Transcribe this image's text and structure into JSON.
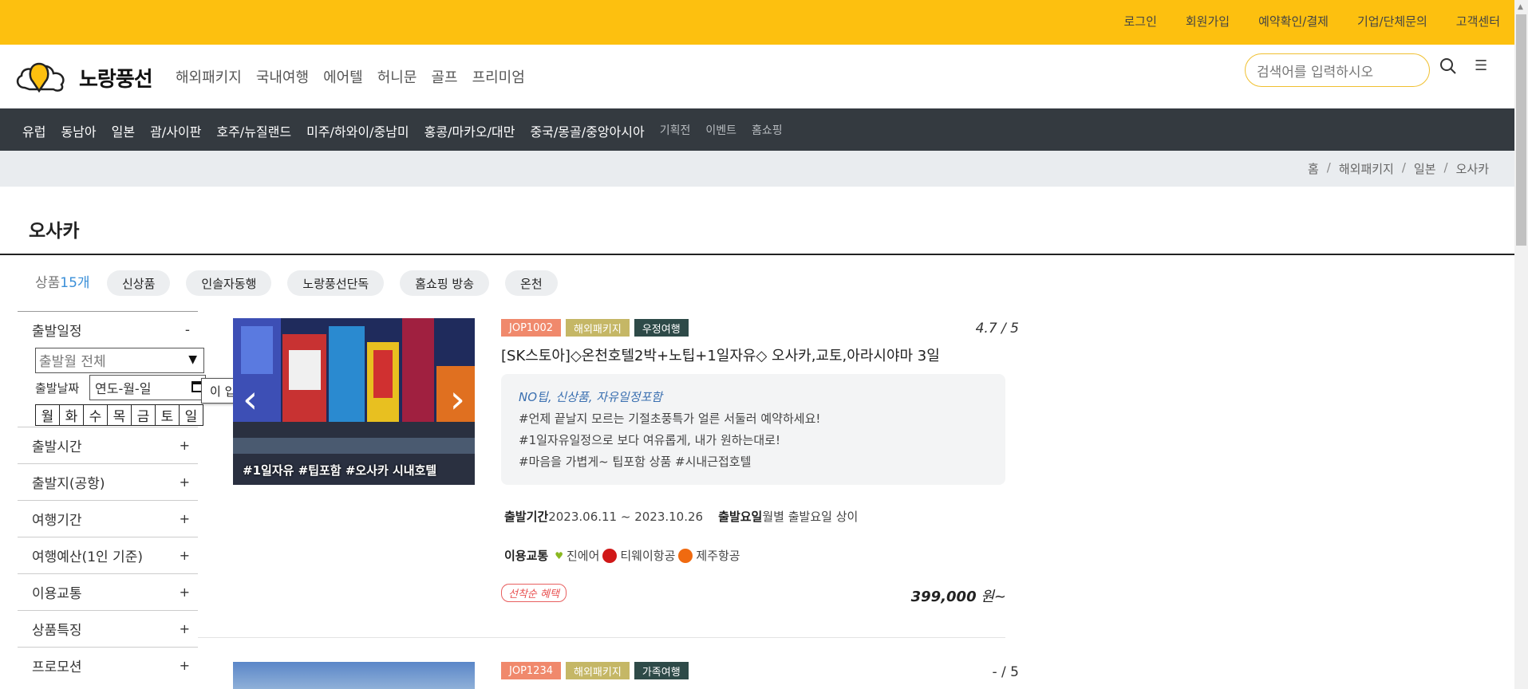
{
  "topbar": {
    "links": [
      "로그인",
      "회원가입",
      "예약확인/결제",
      "기업/단체문의",
      "고객센터"
    ]
  },
  "header": {
    "logo_text": "노랑풍선",
    "nav": [
      "해외패키지",
      "국내여행",
      "에어텔",
      "허니문",
      "골프",
      "프리미엄"
    ],
    "search_placeholder": "검색어를 입력하시오"
  },
  "category_bar": {
    "items": [
      "유럽",
      "동남아",
      "일본",
      "괌/사이판",
      "호주/뉴질랜드",
      "미주/하와이/중남미",
      "홍콩/마카오/대만",
      "중국/몽골/중앙아시아"
    ],
    "sub_items": [
      "기획전",
      "이벤트",
      "홈쇼핑"
    ]
  },
  "breadcrumb": [
    "홈",
    "해외패키지",
    "일본",
    "오사카"
  ],
  "page_title": "오사카",
  "product_count": {
    "label": "상품",
    "count": "15개"
  },
  "filter_chips": [
    "신상품",
    "인솔자동행",
    "노랑풍선단독",
    "홈쇼핑 방송",
    "온천"
  ],
  "sidebar": {
    "departure_schedule": {
      "label": "출발일정",
      "sign": "-"
    },
    "month_select": "출발월 전체",
    "date_label": "출발날짜",
    "date_placeholder": "연도-월-일",
    "tooltip": "이 입력란을 작성하세요.",
    "weekdays": [
      "월",
      "화",
      "수",
      "목",
      "금",
      "토",
      "일"
    ],
    "sections": [
      {
        "label": "출발시간",
        "sign": "+"
      },
      {
        "label": "출발지(공항)",
        "sign": "+"
      },
      {
        "label": "여행기간",
        "sign": "+"
      },
      {
        "label": "여행예산(1인 기준)",
        "sign": "+"
      },
      {
        "label": "이용교통",
        "sign": "+"
      },
      {
        "label": "상품특징",
        "sign": "+"
      },
      {
        "label": "프로모션",
        "sign": "+"
      }
    ]
  },
  "products": [
    {
      "image_caption": "#1일자유 #팁포함 #오사카 시내호텔",
      "code": "JOP1002",
      "category": "해외패키지",
      "theme": "우정여행",
      "rating": "4.7 / 5",
      "title": "[SK스토아]◇온천호텔2박+노팁+1일자유◇ 오사카,교토,아라시야마 3일",
      "highlight": "NO팁, 신상품, 자유일정포함",
      "desc_lines": [
        "#언제 끝날지 모르는 기절초풍특가 얼른 서둘러 예약하세요!",
        "#1일자유일정으로 보다 여유롭게, 내가 원하는대로!",
        "#마음을 가볍게~ 팁포함 상품 #시내근접호텔"
      ],
      "period_label": "출발기간",
      "period": "2023.06.11 ~ 2023.10.26",
      "weekday_label": "출발요일",
      "weekday": "월별 출발요일 상이",
      "transport_label": "이용교통",
      "airlines": [
        "진에어",
        "티웨이항공",
        "제주항공"
      ],
      "promo": "선착순 혜택",
      "price": "399,000",
      "price_unit": "원~"
    },
    {
      "code": "JOP1234",
      "category": "해외패키지",
      "theme": "가족여행",
      "rating": "- / 5"
    }
  ],
  "colors": {
    "brand_yellow": "#fdc00f",
    "dark_bar": "#343a40",
    "badge_code": "#f0896c",
    "badge_pkg": "#c5b766",
    "badge_theme": "#2e4a48"
  }
}
